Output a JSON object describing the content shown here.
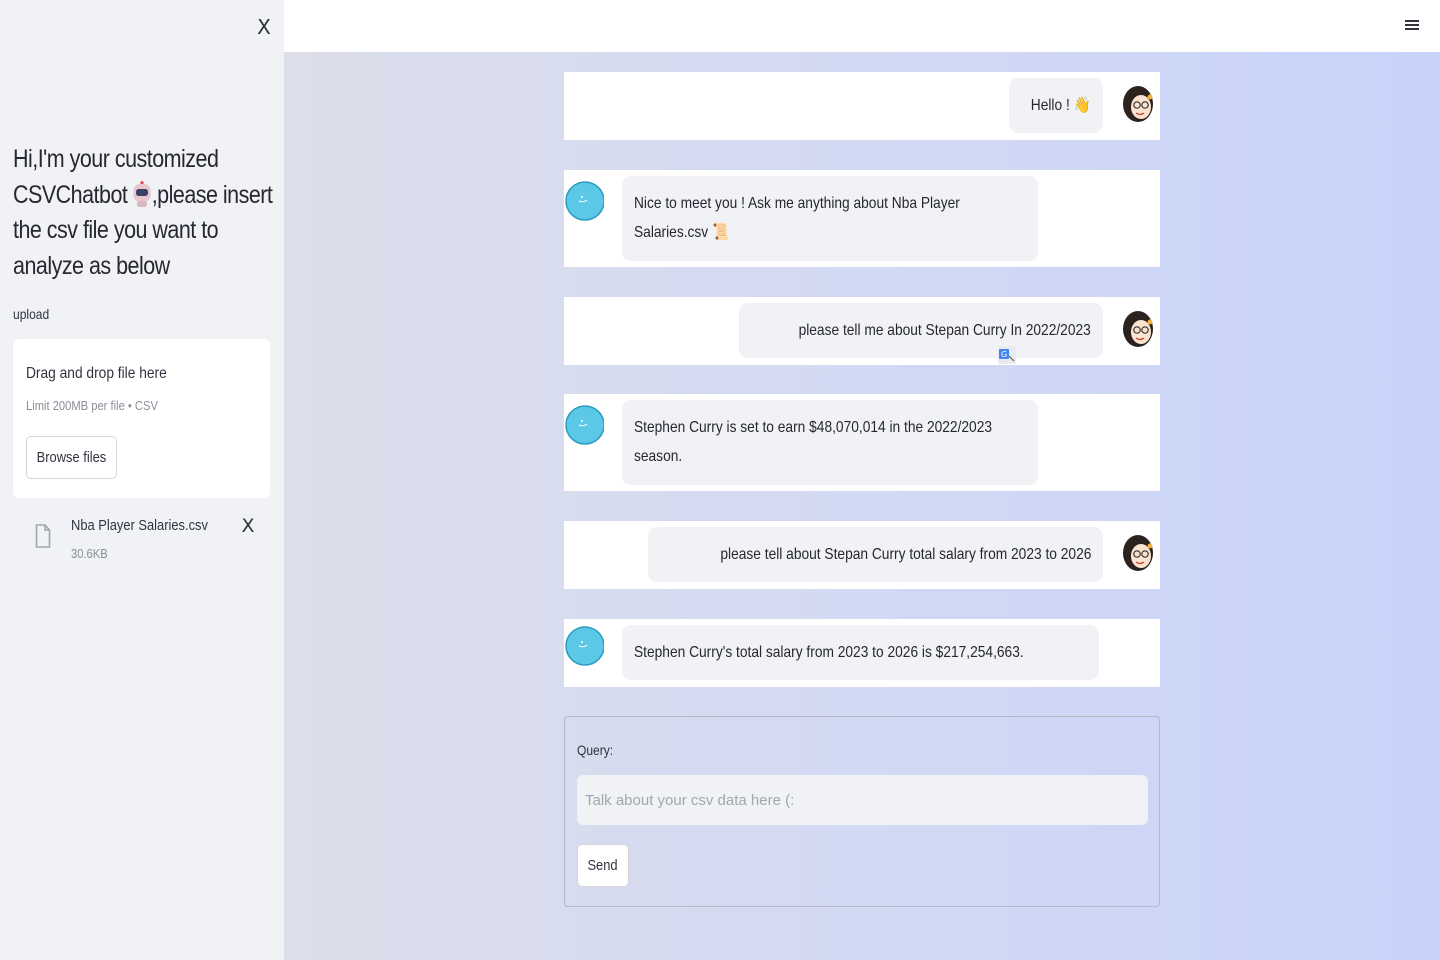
{
  "sidebar": {
    "close_glyph": "X",
    "title_part1": "Hi,I'm your customized CSVChatbot ",
    "title_part2": ",please insert the csv file you want to analyze as below",
    "title_icon": "robot-icon",
    "upload_label": "upload",
    "dropzone": {
      "title": "Drag and drop file here",
      "limit": "Limit 200MB per file • CSV",
      "browse_label": "Browse files"
    },
    "file": {
      "name": "Nba Player Salaries.csv",
      "size": "30.6KB",
      "remove_glyph": "X",
      "icon": "file-icon"
    }
  },
  "header": {
    "menu_icon": "hamburger-menu-icon"
  },
  "chat": {
    "messages": [
      {
        "role": "user",
        "text": "Hello ! 👋"
      },
      {
        "role": "bot",
        "text": "Nice to meet you ! Ask me anything about Nba Player Salaries.csv 📜"
      },
      {
        "role": "user",
        "text": "please tell me about Stepan Curry In 2022/2023"
      },
      {
        "role": "bot",
        "text": "Stephen Curry is set to earn $48,070,014 in the 2022/2023 season."
      },
      {
        "role": "user",
        "text": "please tell about Stepan Curry total salary from 2023 to 2026"
      },
      {
        "role": "bot",
        "text": "Stephen Curry's total salary from 2023 to 2026 is $217,254,663."
      }
    ]
  },
  "query": {
    "label": "Query:",
    "placeholder": "Talk about your csv data here (:",
    "value": "",
    "send_label": "Send"
  },
  "colors": {
    "sidebar_bg": "#f0f2f6",
    "bubble_bg": "#f0f2f6",
    "bot_avatar": "#5bc8e6",
    "main_gradient_start": "#dcdee9",
    "main_gradient_end": "#c8d3fa"
  }
}
